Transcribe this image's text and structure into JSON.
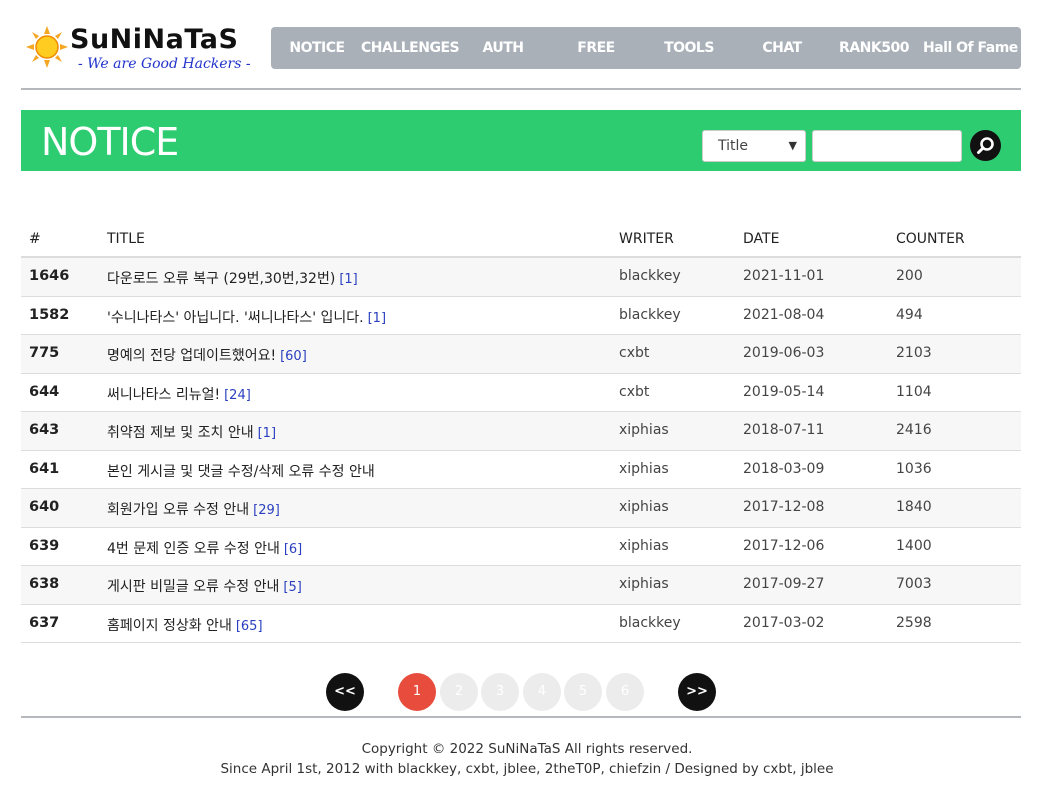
{
  "header": {
    "logo_title": "SuNiNaTaS",
    "logo_tagline": "- We are Good Hackers -",
    "nav": [
      {
        "id": "notice",
        "label": "NOTICE"
      },
      {
        "id": "challenges",
        "label": "CHALLENGES"
      },
      {
        "id": "auth",
        "label": "AUTH"
      },
      {
        "id": "free",
        "label": "FREE"
      },
      {
        "id": "tools",
        "label": "TOOLS"
      },
      {
        "id": "chat",
        "label": "CHAT"
      },
      {
        "id": "rank500",
        "label": "RANK500"
      },
      {
        "id": "hall-of-fame",
        "label": "Hall Of Fame"
      }
    ],
    "nav_color": "#a9b0b8"
  },
  "banner": {
    "title": "NOTICE",
    "color": "#2ecc71",
    "search_field_selected": "Title",
    "search_query": "",
    "search_icon": "search-icon"
  },
  "table": {
    "headers": {
      "num": "#",
      "title": "TITLE",
      "writer": "WRITER",
      "date": "DATE",
      "counter": "COUNTER"
    },
    "rows": [
      {
        "num": "1646",
        "title": "다운로드 오류 복구 (29번,30번,32번)",
        "comments": "[1]",
        "writer": "blackkey",
        "date": "2021-11-01",
        "counter": "200"
      },
      {
        "num": "1582",
        "title": "'수니나타스' 아닙니다. '써니나타스' 입니다.",
        "comments": "[1]",
        "writer": "blackkey",
        "date": "2021-08-04",
        "counter": "494"
      },
      {
        "num": "775",
        "title": "명예의 전당 업데이트했어요!",
        "comments": "[60]",
        "writer": "cxbt",
        "date": "2019-06-03",
        "counter": "2103"
      },
      {
        "num": "644",
        "title": "써니나타스 리뉴얼!",
        "comments": "[24]",
        "writer": "cxbt",
        "date": "2019-05-14",
        "counter": "1104"
      },
      {
        "num": "643",
        "title": "취약점 제보 및 조치 안내",
        "comments": "[1]",
        "writer": "xiphias",
        "date": "2018-07-11",
        "counter": "2416"
      },
      {
        "num": "641",
        "title": "본인 게시글 및 댓글 수정/삭제 오류 수정 안내",
        "comments": "",
        "writer": "xiphias",
        "date": "2018-03-09",
        "counter": "1036"
      },
      {
        "num": "640",
        "title": "회원가입 오류 수정 안내",
        "comments": "[29]",
        "writer": "xiphias",
        "date": "2017-12-08",
        "counter": "1840"
      },
      {
        "num": "639",
        "title": "4번 문제 인증 오류 수정 안내",
        "comments": "[6]",
        "writer": "xiphias",
        "date": "2017-12-06",
        "counter": "1400"
      },
      {
        "num": "638",
        "title": "게시판 비밀글 오류 수정 안내",
        "comments": "[5]",
        "writer": "xiphias",
        "date": "2017-09-27",
        "counter": "7003"
      },
      {
        "num": "637",
        "title": "홈페이지 정상화 안내",
        "comments": "[65]",
        "writer": "blackkey",
        "date": "2017-03-02",
        "counter": "2598"
      }
    ]
  },
  "pagination": {
    "prev": "<<",
    "next": ">>",
    "pages": [
      "1",
      "2",
      "3",
      "4",
      "5",
      "6"
    ],
    "current": "1",
    "active_color": "#e74c3c"
  },
  "footer": {
    "copyright": "Copyright © 2022 SuNiNaTaS All rights reserved.",
    "credits": "Since April 1st, 2012 with blackkey, cxbt, jblee, 2theT0P, chiefzin / Designed by cxbt, jblee"
  }
}
